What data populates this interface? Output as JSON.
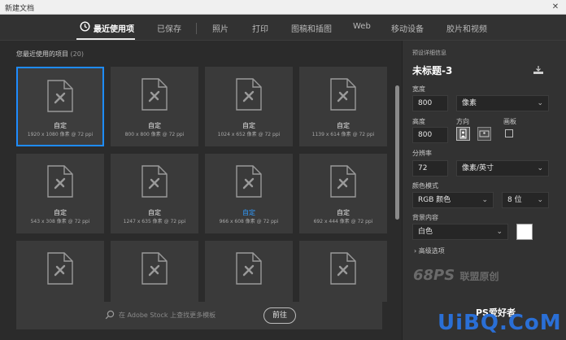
{
  "window": {
    "title": "新建文档",
    "close_glyph": "✕"
  },
  "tabs": [
    {
      "label": "最近使用项",
      "active": true
    },
    {
      "label": "已保存",
      "active": false
    },
    {
      "label": "照片",
      "active": false
    },
    {
      "label": "打印",
      "active": false
    },
    {
      "label": "图稿和插图",
      "active": false
    },
    {
      "label": "Web",
      "active": false
    },
    {
      "label": "移动设备",
      "active": false
    },
    {
      "label": "胶片和视频",
      "active": false
    }
  ],
  "recent": {
    "heading": "您最近使用的项目",
    "count": "(20)",
    "cards": [
      {
        "name": "自定",
        "size": "1920 x 1080 像素 @ 72 ppi",
        "selected": true
      },
      {
        "name": "自定",
        "size": "800 x 800 像素 @ 72 ppi"
      },
      {
        "name": "自定",
        "size": "1024 x 652 像素 @ 72 ppi"
      },
      {
        "name": "自定",
        "size": "1139 x 614 像素 @ 72 ppi"
      },
      {
        "name": "自定",
        "size": "543 x 308 像素 @ 72 ppi"
      },
      {
        "name": "自定",
        "size": "1247 x 635 像素 @ 72 ppi"
      },
      {
        "name": "自定",
        "size": "966 x 608 像素 @ 72 ppi",
        "highlight": true
      },
      {
        "name": "自定",
        "size": "692 x 444 像素 @ 72 ppi"
      },
      {
        "name": "",
        "size": ""
      },
      {
        "name": "",
        "size": ""
      },
      {
        "name": "",
        "size": ""
      },
      {
        "name": "",
        "size": ""
      }
    ]
  },
  "search": {
    "placeholder": "在 Adobe Stock 上查找更多模板",
    "go_label": "前往"
  },
  "details": {
    "section": "预设详细信息",
    "doc_name": "未标题-3",
    "width_label": "宽度",
    "width_value": "800",
    "width_unit": "像素",
    "height_label": "高度",
    "height_value": "800",
    "orientation_label": "方向",
    "artboard_label": "画板",
    "resolution_label": "分辨率",
    "resolution_value": "72",
    "resolution_unit": "像素/英寸",
    "color_mode_label": "颜色模式",
    "color_mode_value": "RGB 颜色",
    "bit_depth": "8 位",
    "background_label": "背景内容",
    "background_value": "白色",
    "background_color": "#ffffff",
    "advanced_label": "高级选项",
    "chevron": "⌄",
    "advanced_caret": "›"
  },
  "watermarks": {
    "ps_logo": "68PS",
    "ps_logo_cn": "联盟原创",
    "uibq": "UiBQ.CoM",
    "ps_cn": "PS爱好者"
  },
  "colors": {
    "accent": "#1e8cff",
    "panel": "#323232",
    "canvas": "#2b2b2b"
  }
}
